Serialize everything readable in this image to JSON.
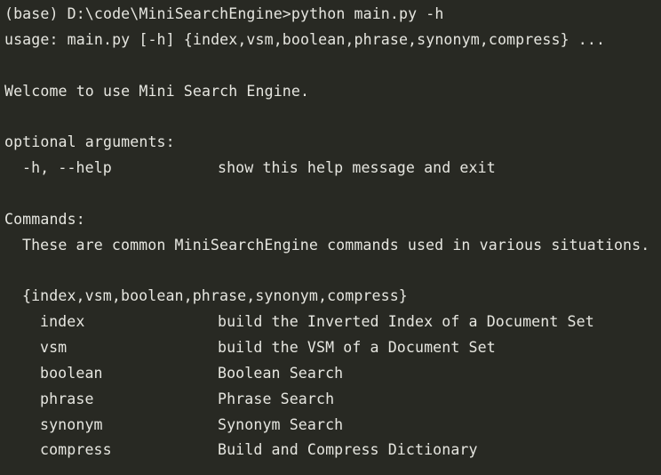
{
  "terminal": {
    "prompt": "(base) D:\\code\\MiniSearchEngine>",
    "command": "python main.py -h",
    "usage": "usage: main.py [-h] {index,vsm,boolean,phrase,synonym,compress} ...",
    "welcome": "Welcome to use Mini Search Engine.",
    "optional_header": "optional arguments:",
    "help_option": {
      "flag": "-h, --help",
      "description": "show this help message and exit"
    },
    "commands_header": "Commands:",
    "commands_description": "These are common MiniSearchEngine commands used in various situations.",
    "subcommand_group": "{index,vsm,boolean,phrase,synonym,compress}",
    "subcommands": [
      {
        "name": "index",
        "description": "build the Inverted Index of a Document Set"
      },
      {
        "name": "vsm",
        "description": "build the VSM of a Document Set"
      },
      {
        "name": "boolean",
        "description": "Boolean Search"
      },
      {
        "name": "phrase",
        "description": "Phrase Search"
      },
      {
        "name": "synonym",
        "description": "Synonym Search"
      },
      {
        "name": "compress",
        "description": "Build and Compress Dictionary"
      }
    ]
  }
}
